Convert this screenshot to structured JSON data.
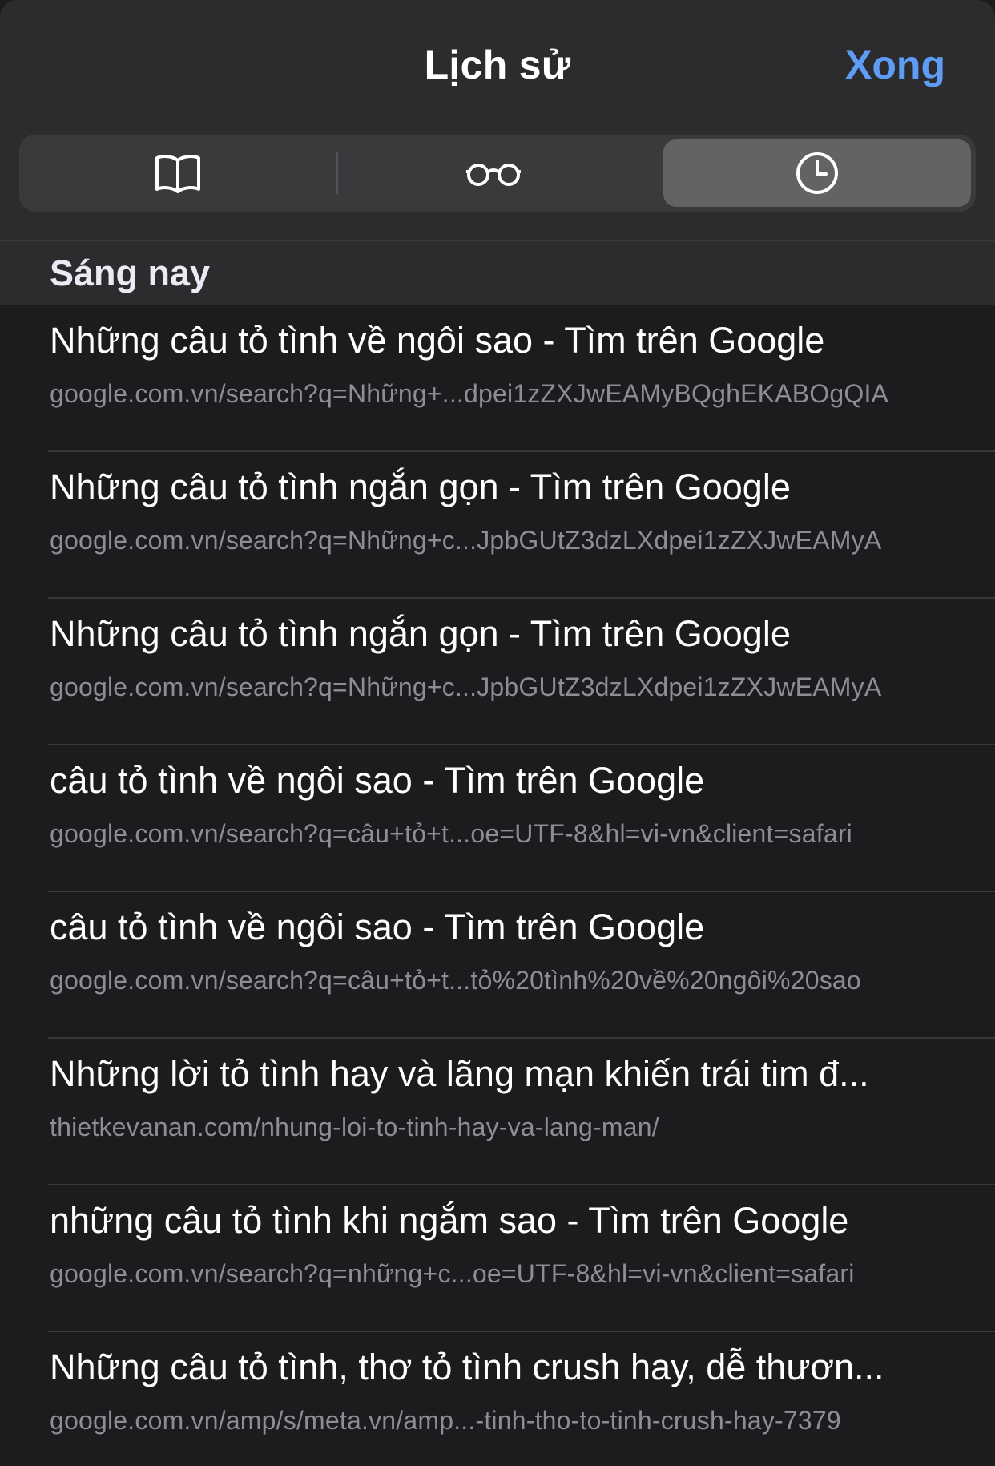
{
  "header": {
    "title": "Lịch sử",
    "done_label": "Xong"
  },
  "segments": [
    {
      "icon": "book-icon",
      "selected": false
    },
    {
      "icon": "glasses-icon",
      "selected": false
    },
    {
      "icon": "clock-icon",
      "selected": true
    }
  ],
  "section": {
    "title": "Sáng nay"
  },
  "items": [
    {
      "title": "Những câu tỏ tình về ngôi sao - Tìm trên Google",
      "url": "google.com.vn/search?q=Những+...dpei1zZXJwEAMyBQghEKABOgQIA"
    },
    {
      "title": "Những câu tỏ tình ngắn gọn - Tìm trên Google",
      "url": "google.com.vn/search?q=Những+c...JpbGUtZ3dzLXdpei1zZXJwEAMyA"
    },
    {
      "title": "Những câu tỏ tình ngắn gọn - Tìm trên Google",
      "url": "google.com.vn/search?q=Những+c...JpbGUtZ3dzLXdpei1zZXJwEAMyA"
    },
    {
      "title": "câu tỏ tình về ngôi sao - Tìm trên Google",
      "url": "google.com.vn/search?q=câu+tỏ+t...oe=UTF-8&hl=vi-vn&client=safari"
    },
    {
      "title": "câu tỏ tình về ngôi sao - Tìm trên Google",
      "url": "google.com.vn/search?q=câu+tỏ+t...tỏ%20tình%20về%20ngôi%20sao"
    },
    {
      "title": "Những lời tỏ tình hay và lãng mạn khiến trái tim đ...",
      "url": "thietkevanan.com/nhung-loi-to-tinh-hay-va-lang-man/"
    },
    {
      "title": "những câu tỏ tình khi ngắm sao - Tìm trên Google",
      "url": "google.com.vn/search?q=những+c...oe=UTF-8&hl=vi-vn&client=safari"
    },
    {
      "title": "Những câu tỏ tình, thơ tỏ tình crush hay, dễ thươn...",
      "url": "google.com.vn/amp/s/meta.vn/amp...-tinh-tho-to-tinh-crush-hay-7379"
    }
  ]
}
